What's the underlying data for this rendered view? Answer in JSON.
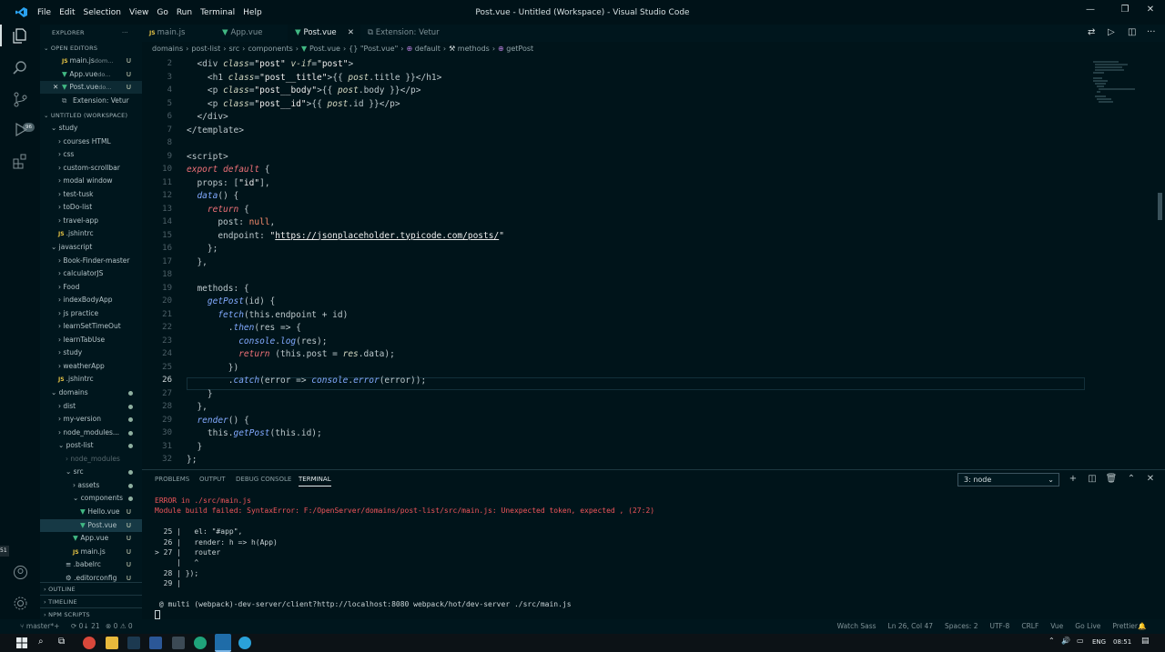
{
  "titlebar": {
    "menu": [
      "File",
      "Edit",
      "Selection",
      "View",
      "Go",
      "Run",
      "Terminal",
      "Help"
    ],
    "title": "Post.vue - Untitled (Workspace) - Visual Studio Code"
  },
  "activity": {
    "badge": "96"
  },
  "sidebar": {
    "explorer_label": "EXPLORER",
    "open_editors_label": "OPEN EDITORS",
    "open_editors": [
      {
        "icon": "JS",
        "name": "main.js",
        "detail": "dom...",
        "status": "U"
      },
      {
        "icon": "V",
        "name": "App.vue",
        "detail": "do...",
        "status": "U"
      },
      {
        "icon": "V",
        "name": "Post.vue",
        "detail": "do...",
        "status": "U"
      },
      {
        "icon": "",
        "name": "Extension: Vetur",
        "detail": "",
        "status": ""
      }
    ],
    "workspace_label": "UNTITLED (WORKSPACE)",
    "tree": [
      {
        "name": "study",
        "indent": 1,
        "kind": "folder-open"
      },
      {
        "name": "courses HTML",
        "indent": 2,
        "kind": "folder"
      },
      {
        "name": "css",
        "indent": 2,
        "kind": "folder"
      },
      {
        "name": "custom-scrollbar",
        "indent": 2,
        "kind": "folder"
      },
      {
        "name": "modal window",
        "indent": 2,
        "kind": "folder"
      },
      {
        "name": "test-tusk",
        "indent": 2,
        "kind": "folder"
      },
      {
        "name": "toDo-list",
        "indent": 2,
        "kind": "folder"
      },
      {
        "name": "travel-app",
        "indent": 2,
        "kind": "folder"
      },
      {
        "name": ".jshintrc",
        "indent": 2,
        "kind": "js"
      },
      {
        "name": "javascript",
        "indent": 1,
        "kind": "folder-open"
      },
      {
        "name": "Book-Finder-master",
        "indent": 2,
        "kind": "folder"
      },
      {
        "name": "calculatorJS",
        "indent": 2,
        "kind": "folder"
      },
      {
        "name": "Food",
        "indent": 2,
        "kind": "folder"
      },
      {
        "name": "indexBodyApp",
        "indent": 2,
        "kind": "folder"
      },
      {
        "name": "js practice",
        "indent": 2,
        "kind": "folder"
      },
      {
        "name": "learnSetTimeOut",
        "indent": 2,
        "kind": "folder"
      },
      {
        "name": "learnTabUse",
        "indent": 2,
        "kind": "folder"
      },
      {
        "name": "study",
        "indent": 2,
        "kind": "folder"
      },
      {
        "name": "weatherApp",
        "indent": 2,
        "kind": "folder"
      },
      {
        "name": ".jshintrc",
        "indent": 2,
        "kind": "js"
      },
      {
        "name": "domains",
        "indent": 1,
        "kind": "folder-open",
        "dot": true
      },
      {
        "name": "dist",
        "indent": 2,
        "kind": "folder",
        "dot": true
      },
      {
        "name": "my-version",
        "indent": 2,
        "kind": "folder",
        "dot": true
      },
      {
        "name": "node_modules...",
        "indent": 2,
        "kind": "folder",
        "dot": true
      },
      {
        "name": "post-list",
        "indent": 2,
        "kind": "folder-open",
        "dot": true
      },
      {
        "name": "node_modules",
        "indent": 3,
        "kind": "folder",
        "dim": true
      },
      {
        "name": "src",
        "indent": 3,
        "kind": "folder-open",
        "dot": true
      },
      {
        "name": "assets",
        "indent": 4,
        "kind": "folder",
        "dot": true
      },
      {
        "name": "components",
        "indent": 4,
        "kind": "folder-open",
        "dot": true
      },
      {
        "name": "Hello.vue",
        "indent": 5,
        "kind": "vue",
        "status": "U"
      },
      {
        "name": "Post.vue",
        "indent": 5,
        "kind": "vue",
        "status": "U",
        "selected": true
      },
      {
        "name": "App.vue",
        "indent": 4,
        "kind": "vue",
        "status": "U"
      },
      {
        "name": "main.js",
        "indent": 4,
        "kind": "js",
        "status": "U"
      },
      {
        "name": ".babelrc",
        "indent": 3,
        "kind": "file",
        "status": "U"
      },
      {
        "name": ".editorconfig",
        "indent": 3,
        "kind": "gear",
        "status": "U"
      }
    ],
    "sections": [
      "OUTLINE",
      "TIMELINE",
      "NPM SCRIPTS"
    ]
  },
  "tabs": [
    {
      "icon": "JS",
      "label": "main.js",
      "active": false
    },
    {
      "icon": "V",
      "label": "App.vue",
      "active": false
    },
    {
      "icon": "V",
      "label": "Post.vue",
      "active": true
    },
    {
      "icon": "",
      "label": "Extension: Vetur",
      "active": false
    }
  ],
  "breadcrumbs": [
    "domains",
    "post-list",
    "src",
    "components",
    "Post.vue",
    "{} \"Post.vue\"",
    "default",
    "methods",
    "getPost"
  ],
  "editor": {
    "current_line": 26,
    "lines": [
      {
        "n": 2,
        "html": "  <span class='tag'>&lt;div</span> <span class='attr'>class</span>=<span class='str'>\"post\"</span> <span class='attr'>v-if</span>=<span class='str'>\"post\"</span><span class='tag'>&gt;</span>"
      },
      {
        "n": 3,
        "html": "    <span class='tag'>&lt;h1</span> <span class='attr'>class</span>=<span class='str'>\"post__title\"</span>&gt;{{ <span class='attr'>post</span>.title }}&lt;/h1&gt;"
      },
      {
        "n": 4,
        "html": "    <span class='tag'>&lt;p</span> <span class='attr'>class</span>=<span class='str'>\"post__body\"</span>&gt;{{ <span class='attr'>post</span>.body }}&lt;/p&gt;"
      },
      {
        "n": 5,
        "html": "    <span class='tag'>&lt;p</span> <span class='attr'>class</span>=<span class='str'>\"post__id\"</span>&gt;{{ <span class='attr'>post</span>.id }}&lt;/p&gt;"
      },
      {
        "n": 6,
        "html": "  &lt;/div&gt;"
      },
      {
        "n": 7,
        "html": "&lt;/template&gt;"
      },
      {
        "n": 8,
        "html": ""
      },
      {
        "n": 9,
        "html": "&lt;script&gt;"
      },
      {
        "n": 10,
        "html": "<span class='kw'>export default</span> {"
      },
      {
        "n": 11,
        "html": "  props: [<span class='str'>\"id\"</span>],"
      },
      {
        "n": 12,
        "html": "  <span class='fn'>data</span>() {"
      },
      {
        "n": 13,
        "html": "    <span class='kw'>return</span> {"
      },
      {
        "n": 14,
        "html": "      post: <span class='nul'>null</span>,"
      },
      {
        "n": 15,
        "html": "      endpoint: <span class='str'>\"<span class='lnk'>https://jsonplaceholder.typicode.com/posts/</span>\"</span>"
      },
      {
        "n": 16,
        "html": "    };"
      },
      {
        "n": 17,
        "html": "  },"
      },
      {
        "n": 18,
        "html": ""
      },
      {
        "n": 19,
        "html": "  methods: {"
      },
      {
        "n": 20,
        "html": "    <span class='fn'>getPost</span>(id) {"
      },
      {
        "n": 21,
        "html": "      <span class='fn'>fetch</span>(this.endpoint + id)"
      },
      {
        "n": 22,
        "html": "        .<span class='fn'>then</span>(res =&gt; {"
      },
      {
        "n": 23,
        "html": "          <span class='fn'>console</span>.<span class='fn'>log</span>(res);"
      },
      {
        "n": 24,
        "html": "          <span class='kw'>return</span> (this.post = <span class='attr'>res</span>.data);"
      },
      {
        "n": 25,
        "html": "        })"
      },
      {
        "n": 26,
        "html": "        .<span class='fn'>catch</span>(error =&gt; <span class='fn'>console</span>.<span class='fn'>error</span>(error));"
      },
      {
        "n": 27,
        "html": "    }"
      },
      {
        "n": 28,
        "html": "  },"
      },
      {
        "n": 29,
        "html": "  <span class='fn'>render</span>() {"
      },
      {
        "n": 30,
        "html": "    this.<span class='fn'>getPost</span>(this.id);"
      },
      {
        "n": 31,
        "html": "  }"
      },
      {
        "n": 32,
        "html": "};"
      }
    ]
  },
  "panel": {
    "tabs": [
      "PROBLEMS",
      "OUTPUT",
      "DEBUG CONSOLE",
      "TERMINAL"
    ],
    "active_tab": "TERMINAL",
    "terminal_select": "3: node",
    "lines": [
      {
        "cls": "err",
        "text": "ERROR in ./src/main.js"
      },
      {
        "cls": "err",
        "text": "Module build failed: SyntaxError: F:/OpenServer/domains/post-list/src/main.js: Unexpected token, expected , (27:2)"
      },
      {
        "cls": "",
        "text": ""
      },
      {
        "cls": "",
        "text": "  25 |   el: \"#app\","
      },
      {
        "cls": "",
        "text": "  26 |   render: h => h(App)"
      },
      {
        "cls": "",
        "text": "> 27 |   router"
      },
      {
        "cls": "",
        "text": "     |   ^"
      },
      {
        "cls": "",
        "text": "  28 | });"
      },
      {
        "cls": "",
        "text": "  29 |"
      },
      {
        "cls": "",
        "text": ""
      },
      {
        "cls": "",
        "text": " @ multi (webpack)-dev-server/client?http://localhost:8080 webpack/hot/dev-server ./src/main.js"
      }
    ]
  },
  "statusbar": {
    "branch": "master*+",
    "sync": "0↓ 21",
    "problems": "⊗ 0 ⚠ 0",
    "right": [
      "Watch Sass",
      "Ln 26, Col 47",
      "Spaces: 2",
      "UTF-8",
      "CRLF",
      "Vue",
      "Go Live",
      "Prettier"
    ]
  },
  "taskbar": {
    "lang": "ENG",
    "time": "08:51"
  },
  "edge_number": "51"
}
